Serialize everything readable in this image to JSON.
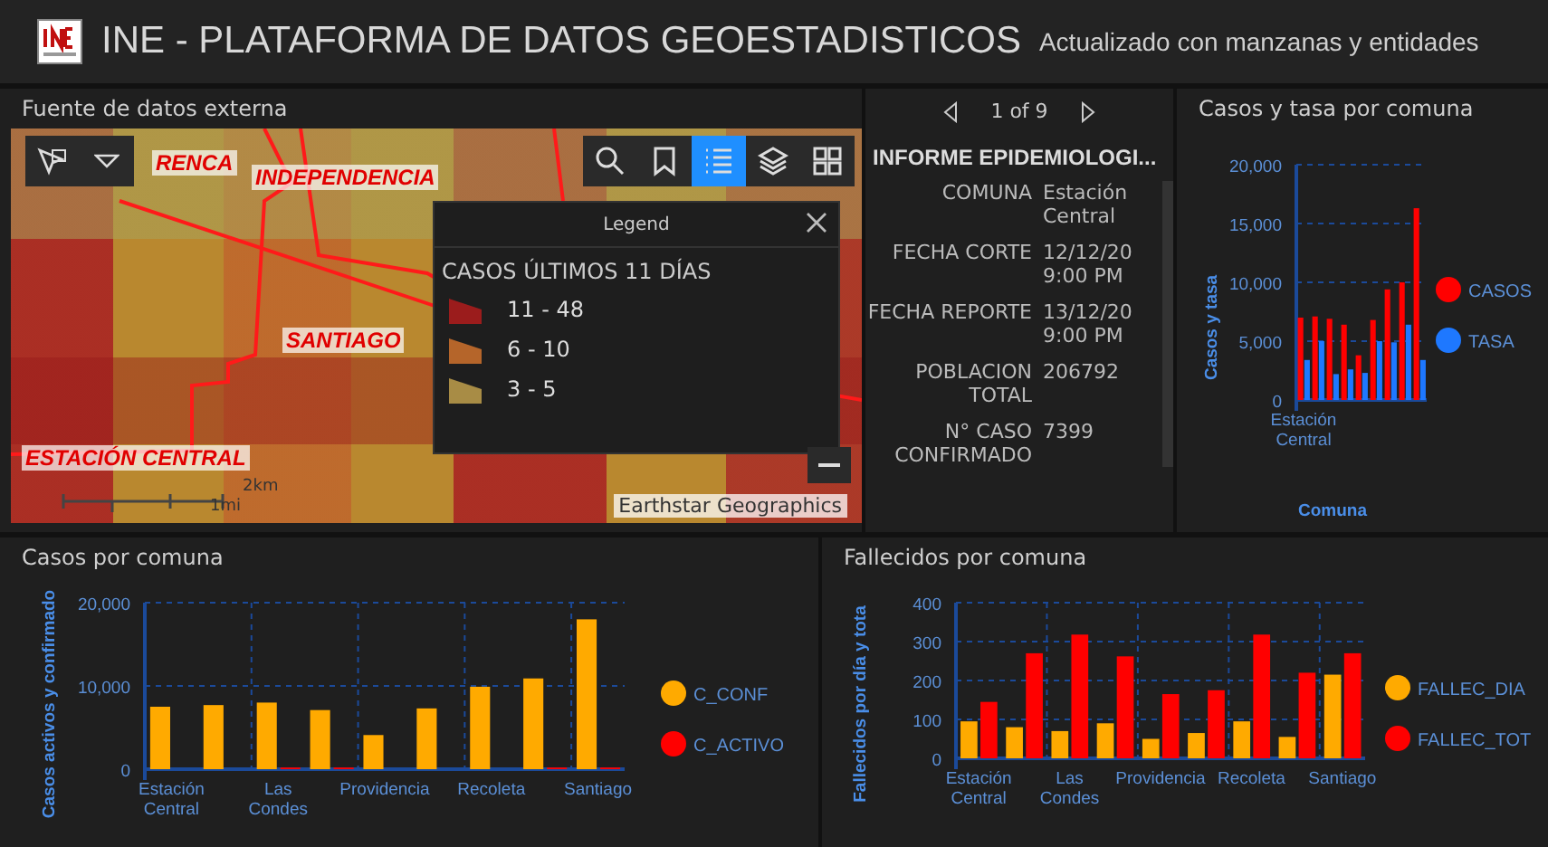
{
  "header": {
    "title": "INE - PLATAFORMA DE DATOS GEOESTADISTICOS",
    "subtitle": "Actualizado con manzanas y entidades"
  },
  "map_panel": {
    "title": "Fuente de datos externa",
    "tools": [
      {
        "kind": "search",
        "selected": false
      },
      {
        "kind": "bookmark",
        "selected": false
      },
      {
        "kind": "legend",
        "selected": true
      },
      {
        "kind": "layers",
        "selected": false
      },
      {
        "kind": "basemap",
        "selected": false
      }
    ],
    "labels": [
      "RENCA",
      "INDEPENDENCIA",
      "SANTIAGO",
      "ESTACIÓN CENTRAL"
    ],
    "scale": {
      "km": "2km",
      "mi": "1mi"
    },
    "attribution": "Earthstar Geographics",
    "legend": {
      "title": "Legend",
      "heading": "CASOS ÚLTIMOS 11 DÍAS",
      "items": [
        {
          "label": "11 - 48",
          "color": "#9b1c1c"
        },
        {
          "label": "6 - 10",
          "color": "#b5652a"
        },
        {
          "label": "3 - 5",
          "color": "#a88c45"
        }
      ]
    }
  },
  "popup": {
    "pager": "1 of 9",
    "title": "INFORME EPIDEMIOLOGI...",
    "fields": [
      {
        "label": "COMUNA",
        "value": "Estación Central"
      },
      {
        "label": "FECHA CORTE",
        "value": "12/12/20 9:00 PM"
      },
      {
        "label": "FECHA REPORTE",
        "value": "13/12/20 9:00 PM"
      },
      {
        "label": "POBLACION TOTAL",
        "value": "206792"
      },
      {
        "label": "N° CASO CONFIRMADO",
        "value": "7399"
      }
    ]
  },
  "casos_tasa": {
    "title": "Casos y tasa por comuna",
    "chart_data": {
      "type": "bar",
      "xlabel": "Comuna",
      "ylabel": "Casos y tasa",
      "categories": [
        "Estación Central",
        null,
        null,
        null,
        null,
        null,
        null,
        null,
        null
      ],
      "yticks": [
        {
          "value": 0,
          "label": "0"
        },
        {
          "value": 5000,
          "label": "5,000"
        },
        {
          "value": 10000,
          "label": "10,000"
        },
        {
          "value": 15000,
          "label": "15,000"
        },
        {
          "value": 20000,
          "label": "20,000"
        }
      ],
      "ylim": [
        0,
        20000
      ],
      "grid": true,
      "legend": "right",
      "series": [
        {
          "name": "CASOS",
          "color": "#ff0000",
          "values": [
            7000,
            7100,
            6900,
            6400,
            3800,
            6800,
            9400,
            10000,
            16300
          ]
        },
        {
          "name": "TASA",
          "color": "#1e78ff",
          "values": [
            3400,
            5000,
            2200,
            2600,
            2300,
            5000,
            4900,
            6400,
            3400
          ]
        }
      ]
    }
  },
  "casos": {
    "title": "Casos por comuna",
    "chart_data": {
      "type": "bar",
      "ylabel": "Casos activos y confirmado",
      "categories": [
        "Estación Central",
        null,
        "Las Condes",
        null,
        "Providencia",
        null,
        "Recoleta",
        null,
        "Santiago"
      ],
      "yticks": [
        {
          "value": 0,
          "label": "0"
        },
        {
          "value": 10000,
          "label": "10,000"
        },
        {
          "value": 20000,
          "label": "20,000"
        }
      ],
      "ylim": [
        0,
        20000
      ],
      "grid": true,
      "legend": "right",
      "series": [
        {
          "name": "C_CONF",
          "color": "#ffaa00",
          "values": [
            7500,
            7700,
            8000,
            7100,
            4100,
            7300,
            9900,
            10900,
            18000
          ]
        },
        {
          "name": "C_ACTIVO",
          "color": "#ff0000",
          "values": [
            0,
            0,
            200,
            200,
            0,
            0,
            0,
            200,
            200
          ]
        }
      ]
    }
  },
  "fallecidos": {
    "title": "Fallecidos por comuna",
    "chart_data": {
      "type": "bar",
      "ylabel": "Fallecidos por día y tota",
      "categories": [
        "Estación Central",
        null,
        "Las Condes",
        null,
        "Providencia",
        null,
        "Recoleta",
        null,
        "Santiago"
      ],
      "yticks": [
        {
          "value": 0,
          "label": "0"
        },
        {
          "value": 100,
          "label": "100"
        },
        {
          "value": 200,
          "label": "200"
        },
        {
          "value": 300,
          "label": "300"
        },
        {
          "value": 400,
          "label": "400"
        }
      ],
      "ylim": [
        0,
        400
      ],
      "grid": true,
      "legend": "right",
      "series": [
        {
          "name": "FALLEC_DIA",
          "color": "#ffaa00",
          "values": [
            95,
            80,
            70,
            90,
            50,
            65,
            95,
            55,
            215
          ]
        },
        {
          "name": "FALLEC_TOT",
          "color": "#ff0000",
          "values": [
            145,
            270,
            318,
            262,
            165,
            175,
            318,
            220,
            270
          ]
        }
      ]
    }
  }
}
